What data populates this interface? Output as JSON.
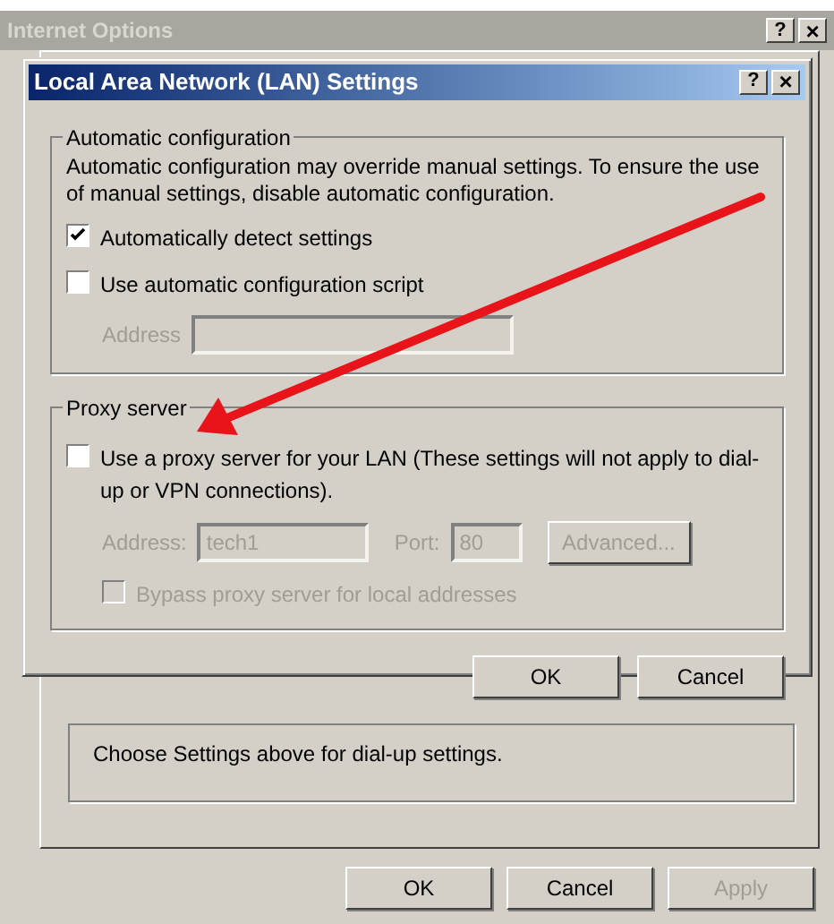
{
  "outer_window": {
    "title": "Internet Options",
    "help_button": "?",
    "close_button": "×",
    "dialup_note": "Choose Settings above for dial-up settings.",
    "buttons": [
      {
        "label": "OK",
        "disabled": false
      },
      {
        "label": "Cancel",
        "disabled": false
      },
      {
        "label": "Apply",
        "disabled": true
      }
    ]
  },
  "dialog": {
    "title": "Local Area Network (LAN) Settings",
    "help_button": "?",
    "close_button": "×",
    "automatic_configuration": {
      "title": "Automatic configuration",
      "description": "Automatic configuration may override manual settings.  To ensure the use of manual settings, disable automatic configuration.",
      "options": [
        {
          "label": "Automatically detect settings",
          "checked": true,
          "disabled": false
        },
        {
          "label": "Use automatic configuration script",
          "checked": false,
          "disabled": false
        }
      ],
      "address": {
        "label": "Address",
        "disabled": true
      }
    },
    "proxy_server": {
      "title": "Proxy server",
      "use_proxy": {
        "label": "Use a proxy server for your LAN (These settings will not apply to dial-up or VPN connections).",
        "checked": false,
        "disabled": false
      },
      "address": {
        "label": "Address:",
        "value": "tech1",
        "disabled": true
      },
      "port": {
        "label": "Port:",
        "value": "80",
        "disabled": true
      },
      "advanced_button": {
        "label": "Advanced...",
        "disabled": true
      },
      "bypass": {
        "label": "Bypass proxy server for local addresses",
        "checked": false,
        "disabled": true
      }
    },
    "buttons": [
      {
        "label": "OK",
        "disabled": false
      },
      {
        "label": "Cancel",
        "disabled": false
      }
    ]
  }
}
